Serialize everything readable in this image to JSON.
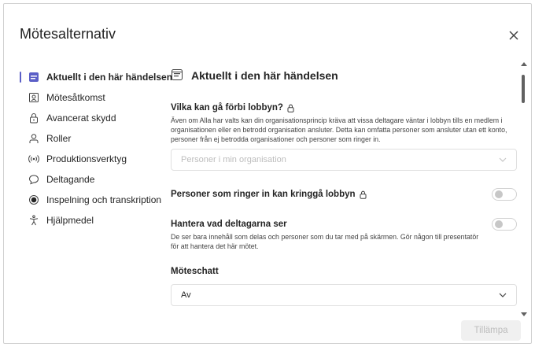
{
  "dialog": {
    "title": "Mötesalternativ",
    "close_icon": "close-icon",
    "apply_label": "Tillämpa"
  },
  "sidebar": {
    "items": [
      {
        "label": "Aktuellt i den här händelsen",
        "icon": "event-icon",
        "active": true
      },
      {
        "label": "Mötesåtkomst",
        "icon": "meeting-access-icon"
      },
      {
        "label": "Avancerat skydd",
        "icon": "lock-icon"
      },
      {
        "label": "Roller",
        "icon": "person-icon"
      },
      {
        "label": "Produktionsverktyg",
        "icon": "broadcast-icon"
      },
      {
        "label": "Deltagande",
        "icon": "chat-icon"
      },
      {
        "label": "Inspelning och transkription",
        "icon": "record-icon"
      },
      {
        "label": "Hjälpmedel",
        "icon": "accessibility-icon"
      }
    ]
  },
  "content": {
    "heading": "Aktuellt i den här händelsen",
    "lobby": {
      "label": "Vilka kan gå förbi lobbyn?",
      "description": "Även om Alla har valts kan din organisationsprincip kräva att vissa deltagare väntar i lobbyn tills en medlem i organisationen eller en betrodd organisation ansluter. Detta kan omfatta personer som ansluter utan ett konto, personer från ej betrodda organisationer och personer som ringer in.",
      "select_value": "Personer i min organisation"
    },
    "dial_in": {
      "label": "Personer som ringer in kan kringgå lobbyn",
      "on": false
    },
    "manage_view": {
      "label": "Hantera vad deltagarna ser",
      "description": "De ser bara innehåll som delas och personer som du tar med på skärmen. Gör någon till presentatör för att hantera det här mötet.",
      "on": false
    },
    "chat": {
      "label": "Möteschatt",
      "select_value": "Av"
    }
  },
  "colors": {
    "accent": "#5b5fc7",
    "text": "#242424",
    "muted": "#bdbdbd"
  }
}
